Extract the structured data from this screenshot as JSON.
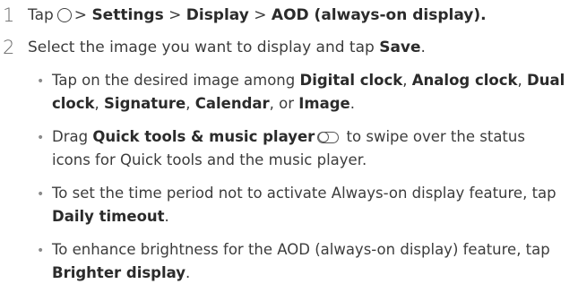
{
  "steps": [
    {
      "number": "1",
      "tap_prefix": "Tap",
      "home_icon": "home-button-icon",
      "path_separator": ">",
      "path": [
        "Settings",
        "Display",
        "AOD (always-on display)."
      ]
    },
    {
      "number": "2",
      "text_before": "Select the image you want to display and tap ",
      "save_label": "Save",
      "text_after": "."
    }
  ],
  "bullets": {
    "b1": {
      "intro": "Tap on the desired image among ",
      "digital_clock": "Digital clock",
      "sep1": ", ",
      "analog_clock": "Analog clock",
      "sep2": ", ",
      "dual": "Dual",
      "clock": "clock",
      "sep3": ", ",
      "signature": "Signature",
      "sep4": ", ",
      "calendar": "Calendar",
      "sep5": ", or ",
      "image": "Image",
      "end": "."
    },
    "b2": {
      "drag": "Drag ",
      "quick_tools": "Quick tools & music player",
      "toggle_icon": "toggle-switch-icon",
      "line1_after": " to swipe over the status",
      "line2": "icons for Quick tools and the music player."
    },
    "b3": {
      "line1": "To set the time period not to activate Always-on display feature, tap",
      "daily_timeout": "Daily timeout",
      "end": "."
    },
    "b4": {
      "line1": "To enhance brightness for the AOD (always-on display) feature, tap",
      "brighter_display": "Brighter display",
      "end": "."
    }
  }
}
